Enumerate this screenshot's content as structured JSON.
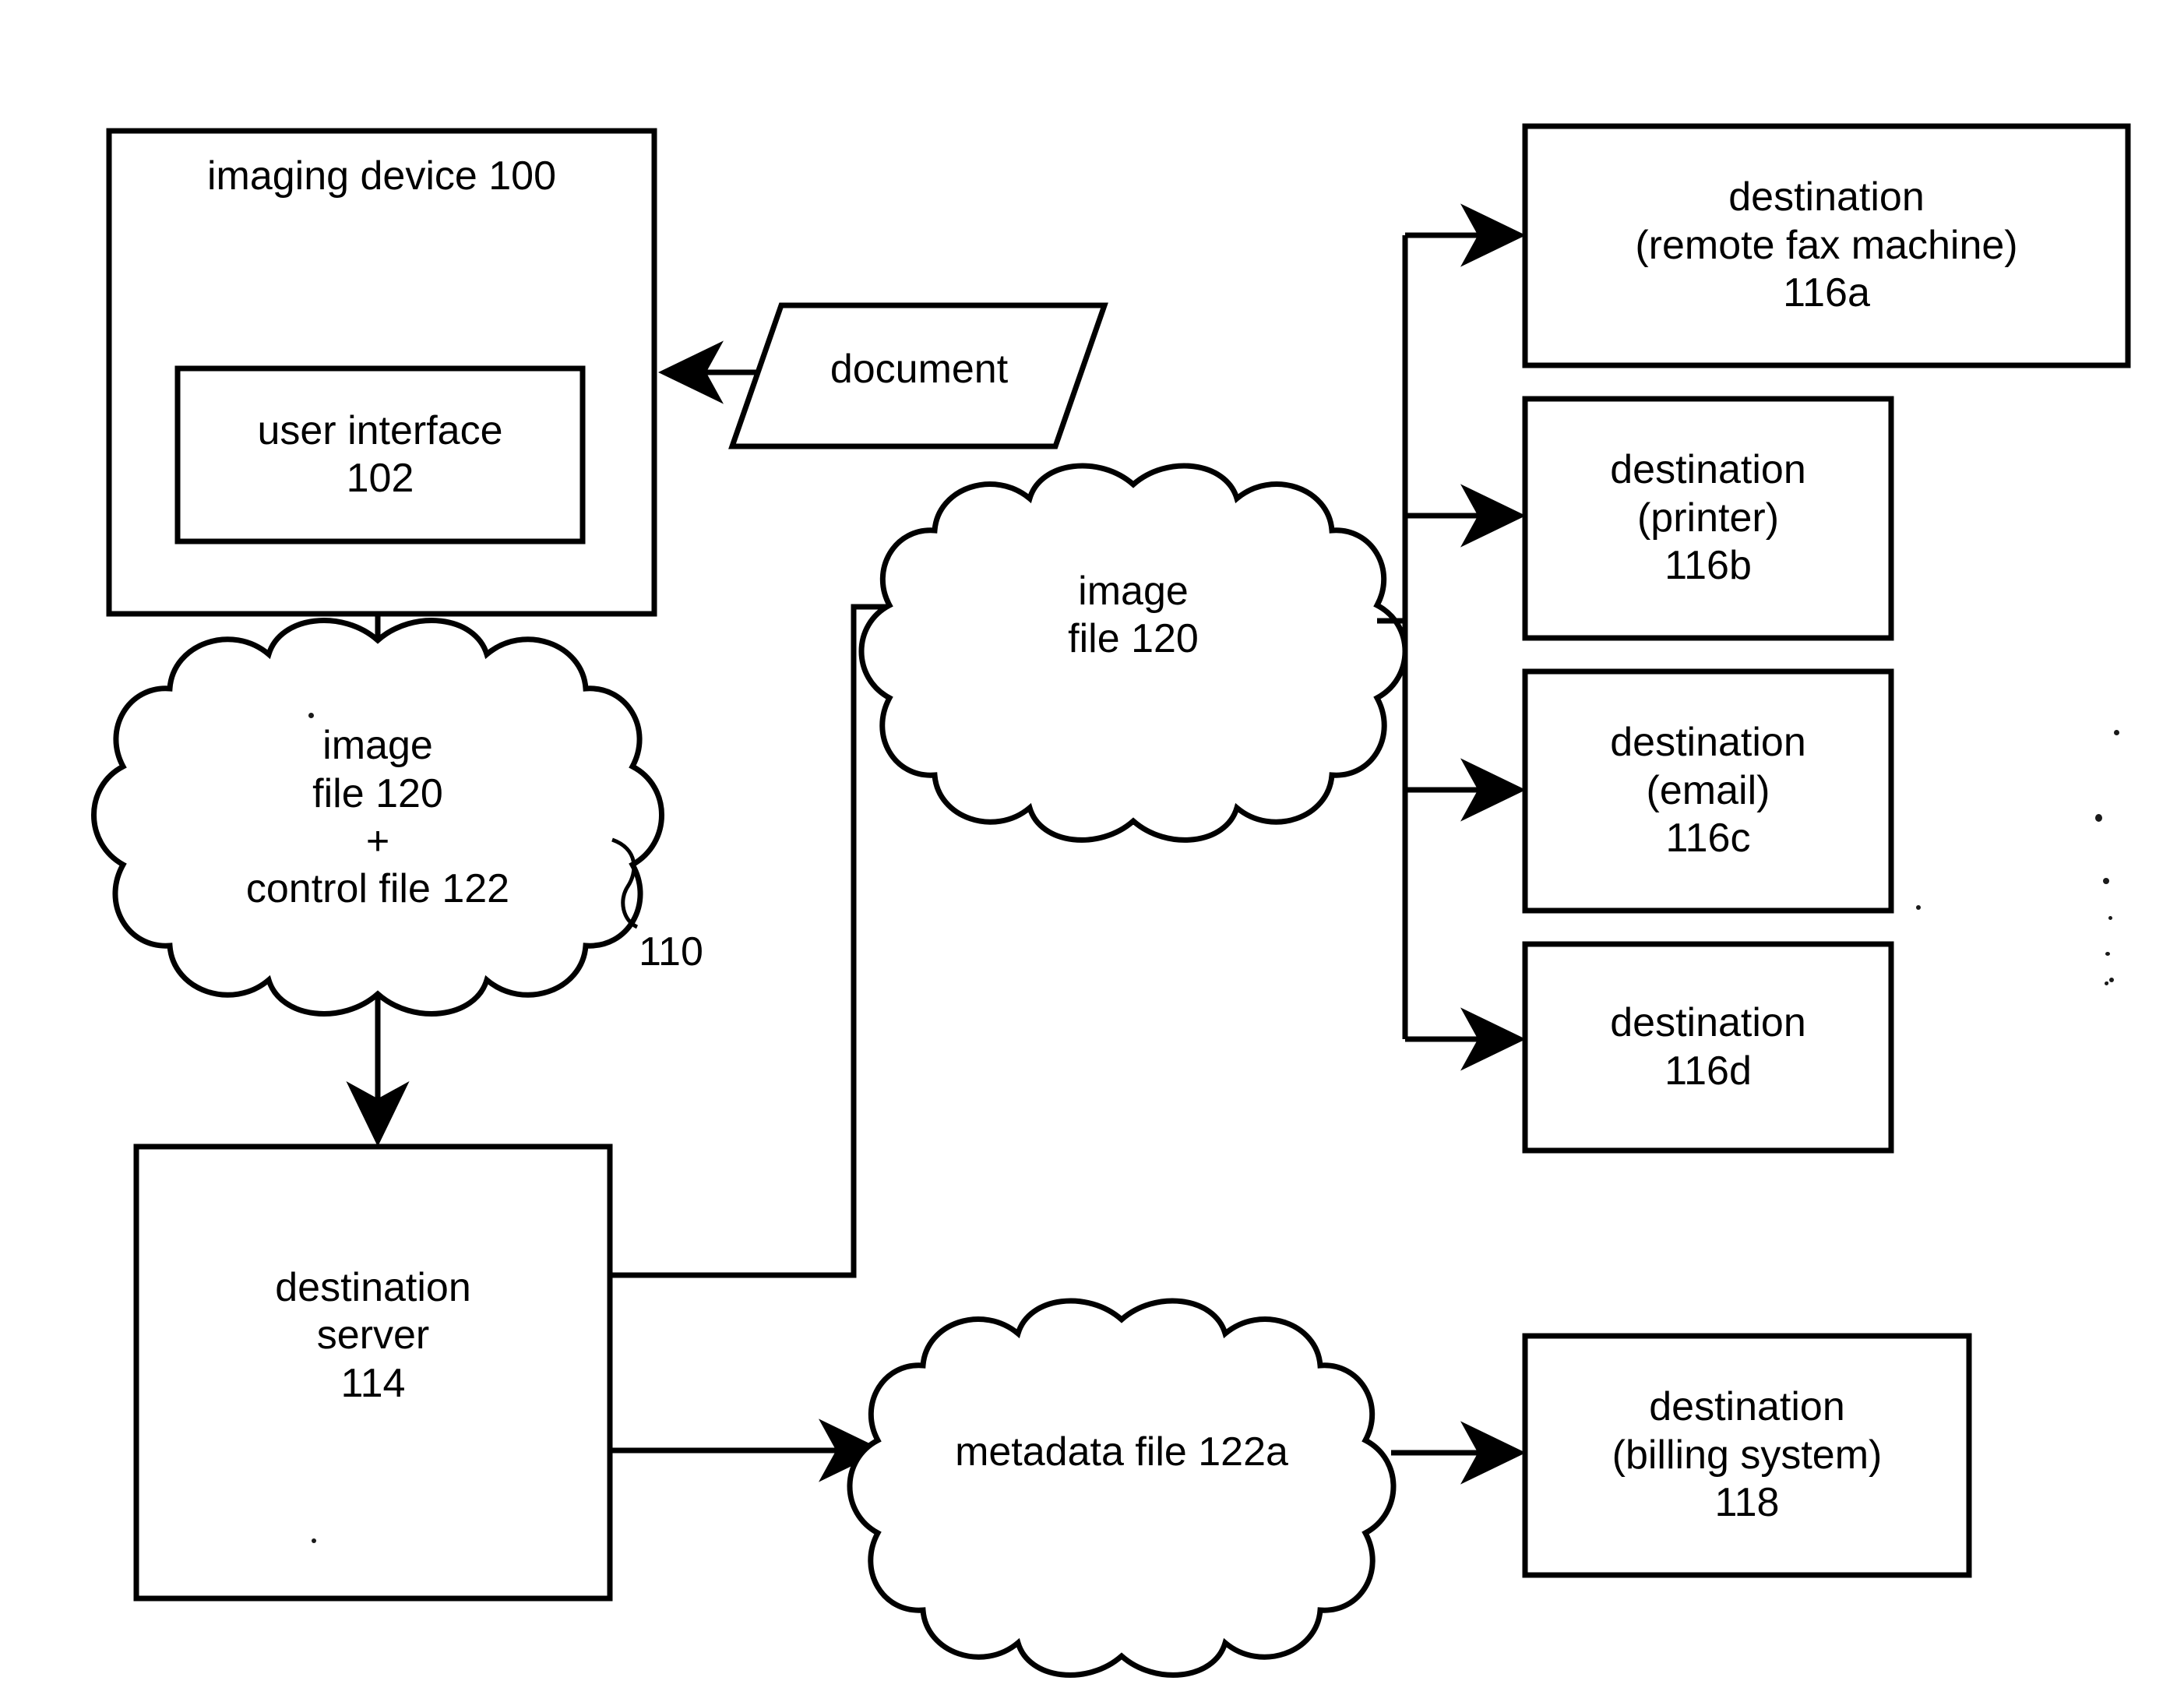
{
  "figure": {
    "type": "patent-block-diagram",
    "background_color": "#ffffff",
    "line_color": "#000000"
  },
  "nodes": {
    "imaging_device": {
      "label_lines": [
        "imaging device 100"
      ],
      "shape": "rectangle"
    },
    "user_interface": {
      "label_lines": [
        "user interface",
        "102"
      ],
      "shape": "rectangle"
    },
    "document": {
      "label_lines": [
        "document"
      ],
      "shape": "parallelogram"
    },
    "cloud_110": {
      "label_lines": [
        "image",
        "file 120",
        "+",
        "control file 122"
      ],
      "shape": "cloud",
      "reference_numeral": "110"
    },
    "cloud_image_file": {
      "label_lines": [
        "image",
        "file 120"
      ],
      "shape": "cloud"
    },
    "destination_server": {
      "label_lines": [
        "destination",
        "server",
        "114"
      ],
      "shape": "rectangle"
    },
    "cloud_metadata": {
      "label_lines": [
        "metadata file 122a"
      ],
      "shape": "cloud"
    },
    "destination_fax": {
      "label_lines": [
        "destination",
        "(remote fax machine)",
        "116a"
      ],
      "shape": "rectangle"
    },
    "destination_printer": {
      "label_lines": [
        "destination",
        "(printer)",
        "116b"
      ],
      "shape": "rectangle"
    },
    "destination_email": {
      "label_lines": [
        "destination",
        "(email)",
        "116c"
      ],
      "shape": "rectangle"
    },
    "destination_generic": {
      "label_lines": [
        "destination",
        "116d"
      ],
      "shape": "rectangle"
    },
    "destination_billing": {
      "label_lines": [
        "destination",
        "(billing system)",
        "118"
      ],
      "shape": "rectangle"
    }
  },
  "connections": [
    {
      "from": "document",
      "to": "imaging_device",
      "arrow": true
    },
    {
      "from": "imaging_device",
      "to": "cloud_110",
      "arrow": false
    },
    {
      "from": "cloud_110",
      "to": "destination_server",
      "arrow": true
    },
    {
      "from": "destination_server",
      "to": "cloud_image_file",
      "arrow": false
    },
    {
      "from": "cloud_image_file",
      "to": "destination_fax",
      "arrow": true
    },
    {
      "from": "cloud_image_file",
      "to": "destination_printer",
      "arrow": true
    },
    {
      "from": "cloud_image_file",
      "to": "destination_email",
      "arrow": true
    },
    {
      "from": "cloud_image_file",
      "to": "destination_generic",
      "arrow": true
    },
    {
      "from": "destination_server",
      "to": "cloud_metadata",
      "arrow": true
    },
    {
      "from": "cloud_metadata",
      "to": "destination_billing",
      "arrow": true
    }
  ]
}
